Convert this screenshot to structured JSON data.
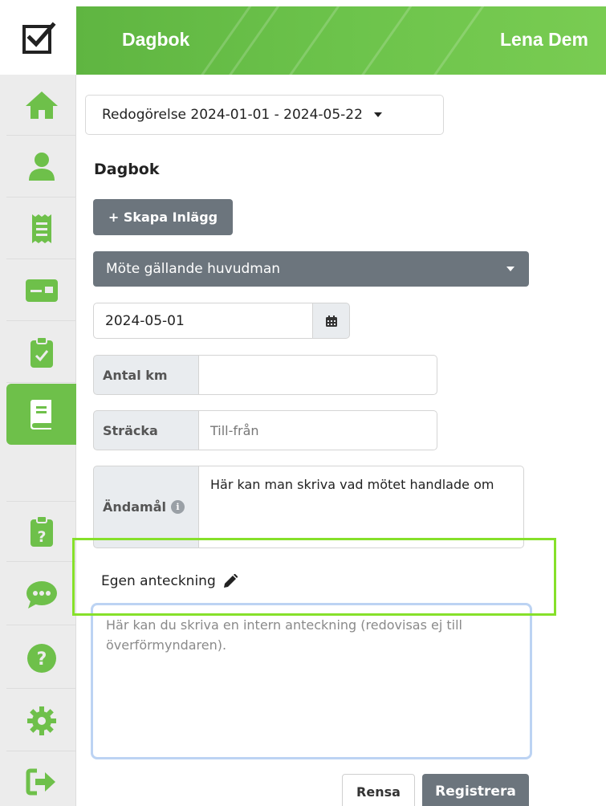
{
  "header": {
    "title": "Dagbok",
    "user_name": "Lena Dem"
  },
  "sidebar": {
    "items": [
      {
        "icon": "home-icon"
      },
      {
        "icon": "user-icon"
      },
      {
        "icon": "receipt-icon"
      },
      {
        "icon": "card-icon"
      },
      {
        "icon": "clipboard-check-icon"
      },
      {
        "icon": "book-icon",
        "active": true
      },
      {
        "icon": "clipboard-question-icon"
      },
      {
        "icon": "chat-icon"
      },
      {
        "icon": "help-icon"
      },
      {
        "icon": "gear-icon"
      },
      {
        "icon": "logout-icon"
      }
    ],
    "accent_color": "#6ec04a"
  },
  "main": {
    "period_selector": "Redogörelse 2024-01-01 - 2024-05-22",
    "section_title": "Dagbok",
    "create_button": "+ Skapa Inlägg",
    "entry_type": "Möte gällande huvudman",
    "date_value": "2024-05-01",
    "km_label": "Antal km",
    "km_value": "",
    "route_label": "Sträcka",
    "route_placeholder": "Till-från",
    "purpose_label": "Ändamål",
    "purpose_value": "Här kan man skriva vad mötet handlade om",
    "note_label": "Egen anteckning",
    "note_placeholder": "Här kan du skriva en intern anteckning (redovisas ej till överförmyndaren).",
    "clear_button": "Rensa",
    "submit_button": "Registrera"
  },
  "colors": {
    "header_green": "#6cc34b",
    "button_gray": "#6c757d",
    "highlight": "#86e02a"
  }
}
